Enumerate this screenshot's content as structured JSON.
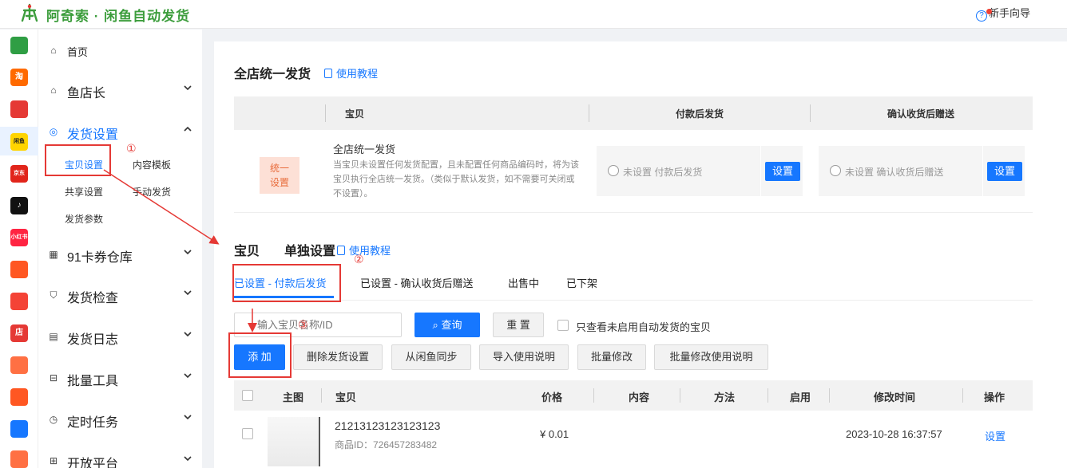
{
  "app": {
    "title": "阿奇索 · 闲鱼自动发货",
    "guide_label": "新手向导"
  },
  "rail": [
    {
      "name": "grid-icon",
      "glyph": "",
      "color": "#2f9e44"
    },
    {
      "name": "taobao-icon",
      "glyph": "淘",
      "color": "#ff6a00"
    },
    {
      "name": "heart-icon",
      "glyph": "",
      "color": "#e53935"
    },
    {
      "name": "xianyu-icon",
      "glyph": "闲鱼",
      "color": "#ffd400"
    },
    {
      "name": "jd-icon",
      "glyph": "京东",
      "color": "#e1251b"
    },
    {
      "name": "douyin-icon",
      "glyph": "♪",
      "color": "#111111"
    },
    {
      "name": "xiaohongshu-icon",
      "glyph": "小红书",
      "color": "#ff2442"
    },
    {
      "name": "circle-app-icon",
      "glyph": "",
      "color": "#ff5722"
    },
    {
      "name": "thumb-icon",
      "glyph": "",
      "color": "#f44336"
    },
    {
      "name": "store-icon",
      "glyph": "店",
      "color": "#e53935"
    },
    {
      "name": "bag-icon",
      "glyph": "",
      "color": "#ff7043"
    },
    {
      "name": "shop-icon",
      "glyph": "",
      "color": "#ff5722"
    },
    {
      "name": "link-app-icon",
      "glyph": "",
      "color": "#1677ff"
    },
    {
      "name": "doc-app-icon",
      "glyph": "",
      "color": "#ff7043"
    }
  ],
  "sidebar": {
    "home": "首页",
    "yu_dianzhang": "鱼店长",
    "delivery_settings": "发货设置",
    "sub": {
      "baobei": "宝贝设置",
      "template": "内容模板",
      "share": "共享设置",
      "manual": "手动发货",
      "params": "发货参数"
    },
    "card_warehouse": "91卡券仓库",
    "delivery_check": "发货检查",
    "delivery_log": "发货日志",
    "batch_tools": "批量工具",
    "scheduled": "定时任务",
    "open_platform": "开放平台"
  },
  "global": {
    "title": "全店统一发货",
    "tutorial": "使用教程",
    "columns": {
      "baobei": "宝贝",
      "after_pay": "付款后发货",
      "after_confirm": "确认收货后赠送"
    },
    "badge": "统一\n设置",
    "row_title": "全店统一发货",
    "row_desc": "当宝贝未设置任何发货配置，且未配置任何商品编码时，将为该宝贝执行全店统一发货。（类似于默认发货，如不需要可关闭或不设置）。",
    "after_pay_status": "未设置 付款后发货",
    "after_confirm_status": "未设置 确认收货后赠送",
    "set_label": "设置"
  },
  "item": {
    "title_a": "宝贝",
    "title_b": "单独设置",
    "tutorial": "使用教程",
    "tabs": [
      "已设置 - 付款后发货",
      "已设置 - 确认收货后赠送",
      "出售中",
      "已下架"
    ],
    "search_placeholder": "输入宝贝名称/ID",
    "query_label": "查询",
    "reset_label": "重 置",
    "only_disabled_label": "只查看未启用自动发货的宝贝",
    "buttons": {
      "add": "添 加",
      "delete": "删除发货设置",
      "sync": "从闲鱼同步",
      "import": "导入使用说明",
      "batch": "批量修改",
      "batch_desc": "批量修改使用说明"
    },
    "columns": {
      "image": "主图",
      "baobei": "宝贝",
      "price": "价格",
      "content": "内容",
      "method": "方法",
      "enabled": "启用",
      "modified": "修改时间",
      "action": "操作"
    },
    "rows": [
      {
        "name": "21213123123123123",
        "product_id": "商品ID：726457283482",
        "price": "¥ 0.01",
        "modified": "2023-10-28 16:37:57",
        "action": "设置"
      }
    ]
  },
  "annotations": {
    "one": "①",
    "two": "②",
    "three": "③"
  }
}
